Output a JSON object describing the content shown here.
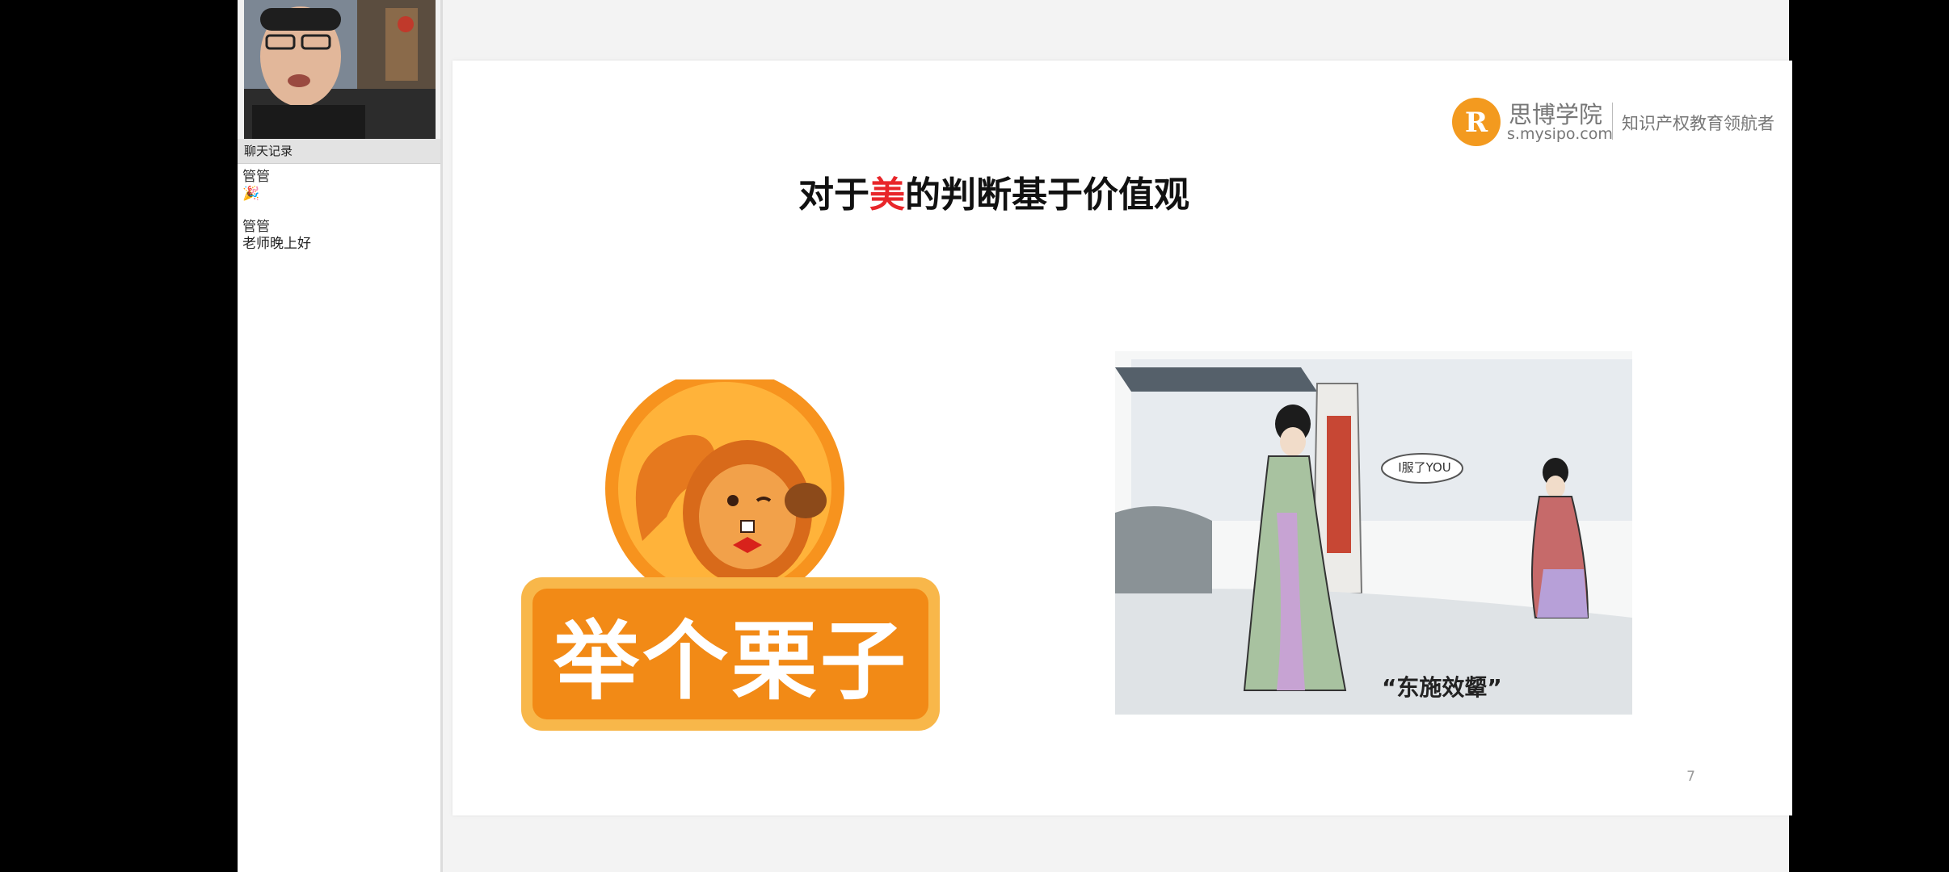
{
  "chat": {
    "header": "聊天记录",
    "messages": [
      {
        "user": "管管",
        "text": "🎉"
      },
      {
        "user": "管管",
        "text": "老师晚上好"
      }
    ]
  },
  "slide": {
    "title_before": "对于",
    "title_highlight": "美",
    "title_after": "的判断基于价值观",
    "page_number": "7",
    "logo": {
      "name": "思博学院",
      "url": "s.mysipo.com",
      "slogan": "知识产权教育领航者"
    },
    "badge_text": "举个栗子",
    "cartoon": {
      "speech": "I服了YOU",
      "caption": "“东施效颦”"
    }
  },
  "colors": {
    "accent_red": "#e8262a",
    "badge_orange": "#f7931e",
    "badge_border": "#f8b74a"
  }
}
